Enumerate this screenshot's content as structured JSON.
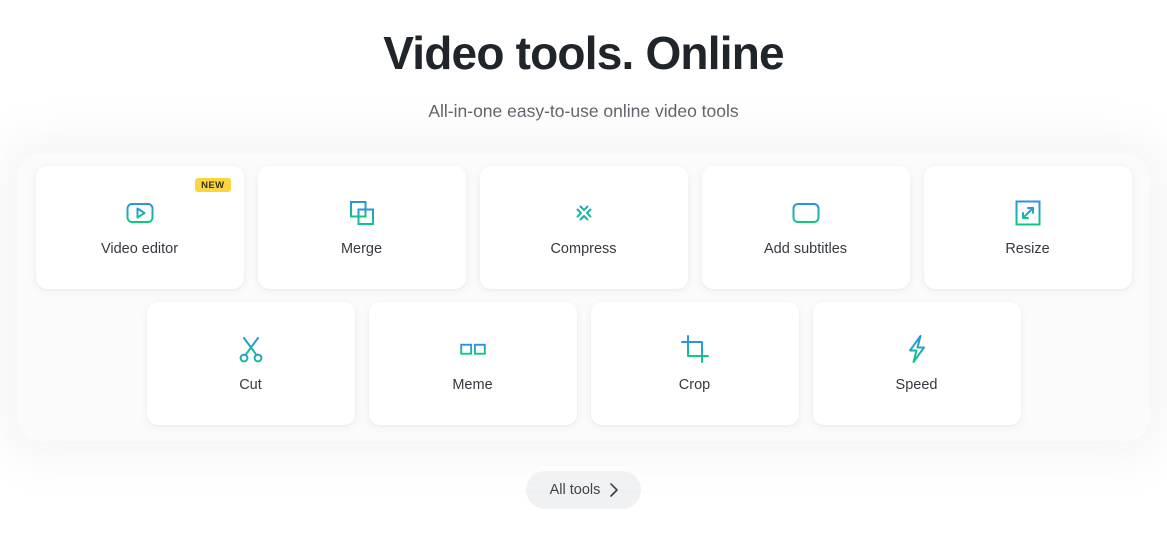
{
  "hero": {
    "title": "Video tools. Online",
    "subtitle": "All-in-one easy-to-use online video tools"
  },
  "theme": {
    "gradient_start": "#2e90e8",
    "gradient_end": "#0fc97f",
    "badge_bg": "#f9d640",
    "badge_text": "#3a3418",
    "page_bg": "#ffffff",
    "card_bg": "#ffffff",
    "label_color": "#35393f",
    "title_color": "#20242b",
    "subtitle_color": "#4b5158",
    "button_bg": "#f0f1f3"
  },
  "tools": {
    "row1": [
      {
        "label": "Video editor",
        "icon": "video-editor-icon",
        "badge": "NEW"
      },
      {
        "label": "Merge",
        "icon": "merge-icon",
        "badge": ""
      },
      {
        "label": "Compress",
        "icon": "compress-icon",
        "badge": ""
      },
      {
        "label": "Add subtitles",
        "icon": "add-subtitles-icon",
        "badge": ""
      },
      {
        "label": "Resize",
        "icon": "resize-icon",
        "badge": ""
      }
    ],
    "row2": [
      {
        "label": "Cut",
        "icon": "cut-icon",
        "badge": ""
      },
      {
        "label": "Meme",
        "icon": "meme-icon",
        "badge": ""
      },
      {
        "label": "Crop",
        "icon": "crop-icon",
        "badge": ""
      },
      {
        "label": "Speed",
        "icon": "speed-icon",
        "badge": ""
      }
    ]
  },
  "footer": {
    "all_tools_label": "All tools",
    "chevron_icon": "chevron-right-icon"
  }
}
